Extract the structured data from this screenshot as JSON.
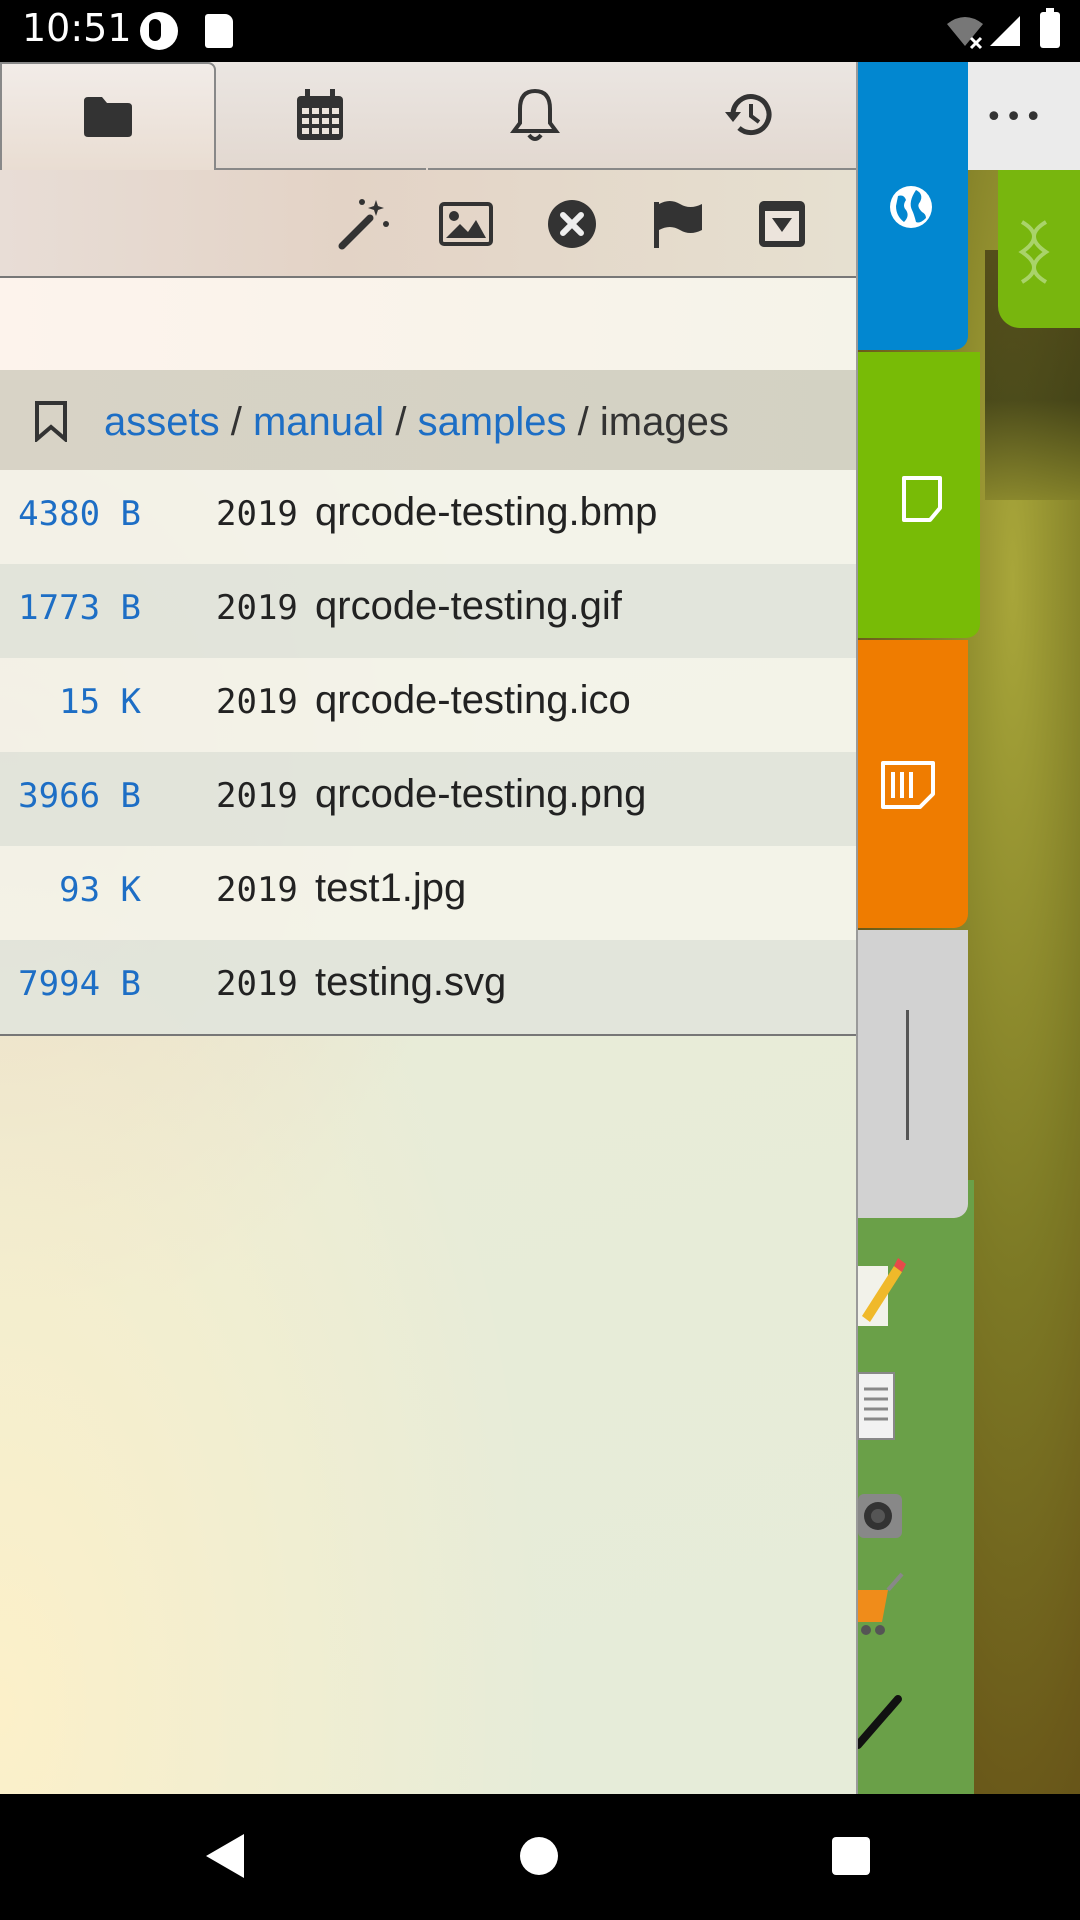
{
  "status_bar": {
    "time": "10:51",
    "icons": [
      "app-notification-icon",
      "sd-card-icon",
      "wifi-off-icon",
      "signal-icon",
      "battery-icon"
    ]
  },
  "tabs": [
    {
      "name": "files",
      "icon": "folder-icon",
      "selected": true
    },
    {
      "name": "calendar",
      "icon": "calendar-icon",
      "selected": false
    },
    {
      "name": "alerts",
      "icon": "bell-icon",
      "selected": false
    },
    {
      "name": "history",
      "icon": "history-icon",
      "selected": false
    }
  ],
  "toolbar": [
    "magic-wand-icon",
    "image-icon",
    "close-circle-icon",
    "flag-icon",
    "dropdown-box-icon"
  ],
  "breadcrumb": {
    "items": [
      "assets",
      "manual",
      "samples"
    ],
    "current": "images",
    "separator": "/"
  },
  "files": [
    {
      "size": "4380 B",
      "year": "2019",
      "name": "qrcode-testing.bmp"
    },
    {
      "size": "1773 B",
      "year": "2019",
      "name": "qrcode-testing.gif"
    },
    {
      "size": "15 K",
      "year": "2019",
      "name": "qrcode-testing.ico"
    },
    {
      "size": "3966 B",
      "year": "2019",
      "name": "qrcode-testing.png"
    },
    {
      "size": "93 K",
      "year": "2019",
      "name": "test1.jpg"
    },
    {
      "size": "7994 B",
      "year": "2019",
      "name": "testing.svg"
    }
  ],
  "side_tabs": {
    "more": "•••",
    "items": [
      {
        "name": "web",
        "icon": "globe-icon",
        "color": "#0287d0"
      },
      {
        "name": "notes",
        "icon": "note-icon",
        "color": "#78bb06"
      },
      {
        "name": "sticky",
        "icon": "sticky-note-icon",
        "color": "#ef7c00"
      },
      {
        "name": "handle",
        "icon": "drag-handle-icon",
        "color": "#d2d2d2"
      },
      {
        "name": "dna",
        "icon": "dna-icon",
        "color": "#78b60e"
      }
    ]
  },
  "accent_color": "#1d6ec5"
}
